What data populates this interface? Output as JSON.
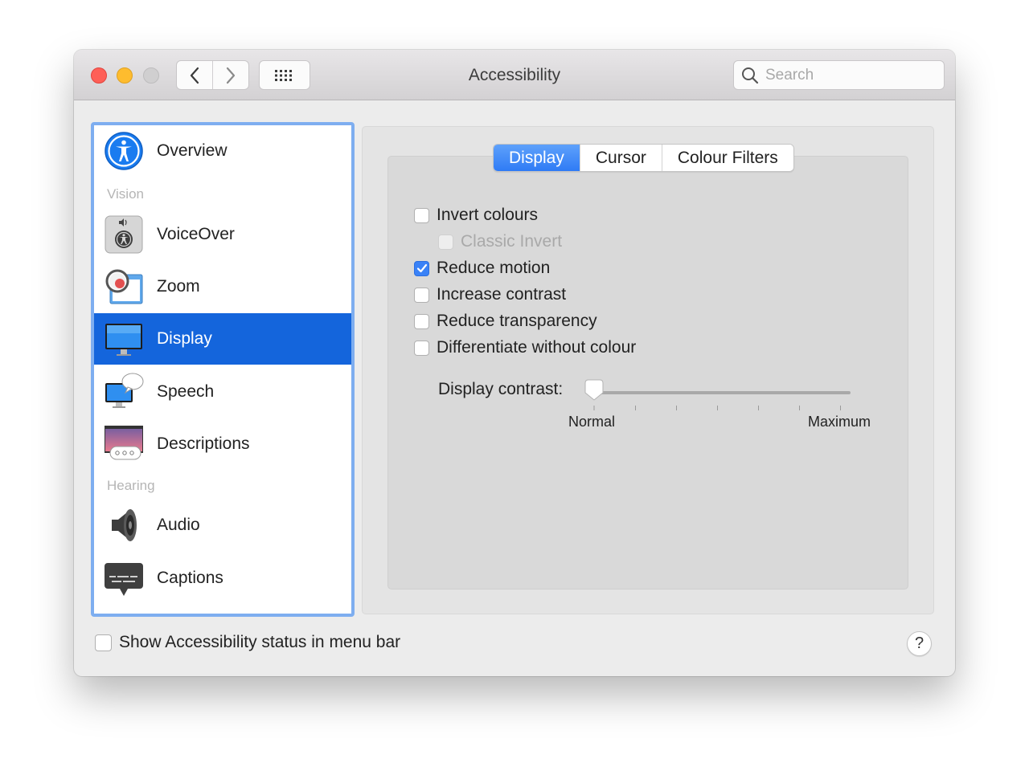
{
  "window": {
    "title": "Accessibility",
    "search": {
      "placeholder": "Search",
      "value": ""
    }
  },
  "sidebar": {
    "overview": {
      "label": "Overview",
      "icon": "accessibility-icon"
    },
    "vision_header": "Vision",
    "voiceover": {
      "label": "VoiceOver",
      "icon": "voiceover-icon"
    },
    "zoom": {
      "label": "Zoom",
      "icon": "zoom-icon"
    },
    "display": {
      "label": "Display",
      "icon": "display-icon",
      "selected": true
    },
    "speech": {
      "label": "Speech",
      "icon": "speech-icon"
    },
    "descriptions": {
      "label": "Descriptions",
      "icon": "descriptions-icon"
    },
    "hearing_header": "Hearing",
    "audio": {
      "label": "Audio",
      "icon": "speaker-icon"
    },
    "captions": {
      "label": "Captions",
      "icon": "captions-icon"
    }
  },
  "tabs": {
    "display": "Display",
    "cursor": "Cursor",
    "colour_filters": "Colour Filters",
    "active": "Display"
  },
  "options": {
    "invert_colours": {
      "label": "Invert colours",
      "checked": false
    },
    "classic_invert": {
      "label": "Classic Invert",
      "checked": false,
      "disabled": true
    },
    "reduce_motion": {
      "label": "Reduce motion",
      "checked": true
    },
    "increase_contrast": {
      "label": "Increase contrast",
      "checked": false
    },
    "reduce_transparency": {
      "label": "Reduce transparency",
      "checked": false
    },
    "differentiate_without_colour": {
      "label": "Differentiate without colour",
      "checked": false
    }
  },
  "contrast": {
    "label": "Display contrast:",
    "min_label": "Normal",
    "max_label": "Maximum",
    "value": 0
  },
  "footer": {
    "show_status": {
      "label": "Show Accessibility status in menu bar",
      "checked": false
    },
    "help": "?"
  },
  "colors": {
    "accent": "#1465dc",
    "checkbox_checked": "#3a82f7",
    "tab_active": "#3b86f7",
    "close": "#fe5f57",
    "minimize": "#febc2e",
    "zoom_disabled": "#d0cfd0"
  }
}
